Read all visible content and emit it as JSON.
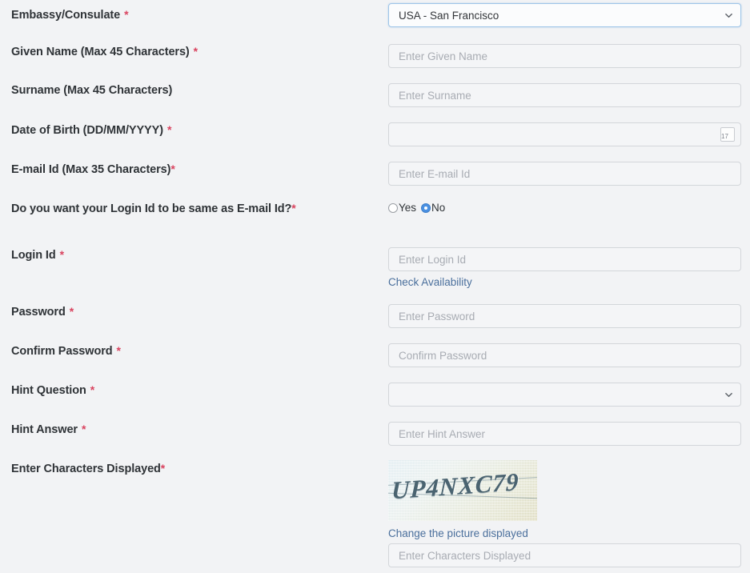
{
  "form": {
    "fields": [
      {
        "id": "embassy",
        "label": "Embassy/Consulate",
        "required": true,
        "control": "select",
        "value": "USA - San Francisco",
        "focused": true
      },
      {
        "id": "given-name",
        "label": "Given Name (Max 45 Characters)",
        "required": true,
        "control": "text",
        "placeholder": "Enter Given Name",
        "value": ""
      },
      {
        "id": "surname",
        "label": "Surname (Max 45 Characters)",
        "required": false,
        "control": "text",
        "placeholder": "Enter Surname",
        "value": ""
      },
      {
        "id": "dob",
        "label": "Date of Birth (DD/MM/YYYY)",
        "required": true,
        "control": "date",
        "placeholder": "",
        "value": "",
        "icon": "calendar-icon",
        "icon_day": "17"
      },
      {
        "id": "email",
        "label": "E-mail Id (Max 35 Characters)",
        "required": true,
        "control": "text",
        "placeholder": "Enter E-mail Id",
        "value": ""
      },
      {
        "id": "login-same-as-email",
        "label": "Do you want your Login Id to be same as E-mail Id?",
        "required": true,
        "control": "radio",
        "options": [
          "Yes",
          "No"
        ],
        "selected": "No"
      },
      {
        "id": "login-id",
        "label": "Login Id",
        "required": true,
        "control": "text",
        "placeholder": "Enter Login Id",
        "value": "",
        "link": "Check Availability"
      },
      {
        "id": "password",
        "label": "Password",
        "required": true,
        "control": "password",
        "placeholder": "Enter Password",
        "value": ""
      },
      {
        "id": "confirm-password",
        "label": "Confirm Password",
        "required": true,
        "control": "password",
        "placeholder": "Confirm Password",
        "value": ""
      },
      {
        "id": "hint-question",
        "label": "Hint Question",
        "required": true,
        "control": "select",
        "value": ""
      },
      {
        "id": "hint-answer",
        "label": "Hint Answer",
        "required": true,
        "control": "text",
        "placeholder": "Enter Hint Answer",
        "value": ""
      },
      {
        "id": "captcha",
        "label": "Enter Characters Displayed",
        "required": true,
        "control": "captcha",
        "captcha_text": "UP4NXC79",
        "link": "Change the picture displayed",
        "placeholder": "Enter Characters Displayed",
        "value": ""
      }
    ],
    "required_marker": "*"
  },
  "colors": {
    "page_background": "#f2f3f5",
    "label_text": "#2f3337",
    "required_asterisk": "#d9435f",
    "input_border": "#d3d6da",
    "input_background": "#f4f5f7",
    "placeholder_text": "#a8acb3",
    "link_text": "#4a6f9c",
    "radio_selected": "#4a90e2",
    "focus_border": "#9ec5e8",
    "calendar_icon_header": "#d9954f"
  }
}
